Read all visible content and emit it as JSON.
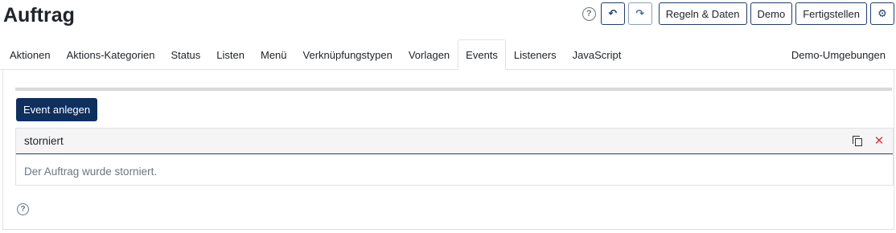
{
  "header": {
    "title": "Auftrag",
    "help_icon": "question-circle-icon",
    "undo_icon": "undo-icon",
    "redo_icon": "redo-icon",
    "buttons": {
      "rules_data": "Regeln & Daten",
      "demo": "Demo",
      "finish": "Fertigstellen"
    },
    "settings_icon": "gear-icon"
  },
  "tabs": {
    "items": [
      {
        "label": "Aktionen"
      },
      {
        "label": "Aktions-Kategorien"
      },
      {
        "label": "Status"
      },
      {
        "label": "Listen"
      },
      {
        "label": "Menü"
      },
      {
        "label": "Verknüpfungstypen"
      },
      {
        "label": "Vorlagen"
      },
      {
        "label": "Events"
      },
      {
        "label": "Listeners"
      },
      {
        "label": "JavaScript"
      }
    ],
    "active": "Events",
    "right_label": "Demo-Umgebungen"
  },
  "events": {
    "create_button": "Event anlegen",
    "items": [
      {
        "name": "storniert",
        "description": "Der Auftrag wurde storniert.",
        "copy_icon": "copy-icon",
        "delete_icon": "close-icon"
      }
    ]
  },
  "colors": {
    "primary": "#0f2f5f",
    "delete": "#dc3545",
    "muted_text": "#6c757d"
  }
}
